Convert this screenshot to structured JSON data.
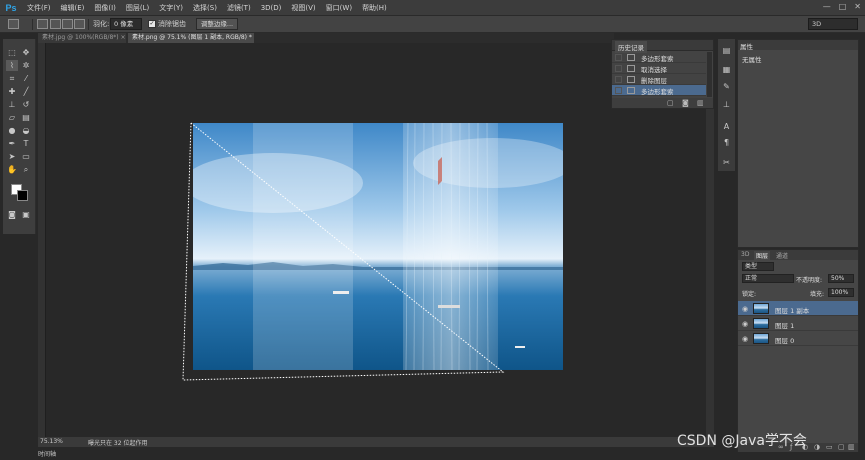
{
  "app": {
    "logo": "Ps"
  },
  "menu": [
    "文件(F)",
    "编辑(E)",
    "图像(I)",
    "图层(L)",
    "文字(Y)",
    "选择(S)",
    "滤镜(T)",
    "3D(D)",
    "视图(V)",
    "窗口(W)",
    "帮助(H)"
  ],
  "window_controls": [
    "—",
    "□",
    "✕"
  ],
  "options": {
    "feather_label": "羽化:",
    "feather_value": "0 像素",
    "antialias_label": "消除锯齿",
    "antialias_checked": true,
    "refine_edge_label": "调整边缘...",
    "workspace": "3D"
  },
  "tabs": [
    {
      "label": "素材.jpg @ 100%(RGB/8*) ×",
      "active": false
    },
    {
      "label": "素材.png @ 75.1% (图层 1 副本, RGB/8) * ×",
      "active": true
    }
  ],
  "status": {
    "zoom": "75.13%",
    "doc_info": "曝光只在 32 位起作用",
    "timeline": "时间轴"
  },
  "history": {
    "title": "历史记录",
    "items": [
      {
        "label": "多边形套索",
        "selected": false
      },
      {
        "label": "取消选择",
        "selected": false
      },
      {
        "label": "删除图层",
        "selected": false
      },
      {
        "label": "多边形套索",
        "selected": true
      }
    ]
  },
  "properties": {
    "title": "属性",
    "value": "无属性"
  },
  "layers": {
    "tabs": [
      "3D",
      "图层",
      "通道"
    ],
    "kind_filter": "类型",
    "blend_mode": "正常",
    "opacity_label": "不透明度:",
    "opacity_value": "50%",
    "lock_label": "锁定:",
    "fill_label": "填充:",
    "fill_value": "100%",
    "items": [
      {
        "name": "图层 1 副本",
        "selected": true
      },
      {
        "name": "图层 1",
        "selected": false
      },
      {
        "name": "图层 0",
        "selected": false
      }
    ]
  },
  "watermark": "CSDN @Java学不会",
  "colors": {
    "accent_logo": "#2fa4e7",
    "selection_highlight": "#4b6a8f"
  }
}
